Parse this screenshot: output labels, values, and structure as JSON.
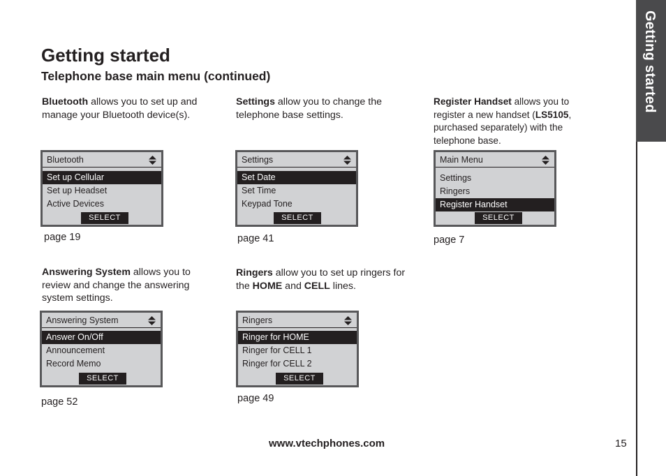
{
  "page": {
    "title": "Getting started",
    "section_title": "Telephone base main menu (continued)",
    "side_tab": "Getting started",
    "footer_url": "www.vtechphones.com",
    "page_number": "15"
  },
  "panels": [
    {
      "desc_bold": "Bluetooth",
      "desc_rest": " allows you to set up and manage your Bluetooth device(s).",
      "screen": {
        "header": "Bluetooth",
        "header_icon": "up-down-arrows-icon",
        "items": [
          "Set up Cellular",
          "Set up Headset",
          "Active Devices"
        ],
        "selected_index": 0,
        "softkey": "SELECT"
      },
      "page_ref": "page 19"
    },
    {
      "desc_bold": "Settings",
      "desc_rest": " allow you to change the telephone base settings.",
      "screen": {
        "header": "Settings",
        "header_icon": "up-down-arrows-icon",
        "items": [
          "Set Date",
          "Set Time",
          "Keypad Tone"
        ],
        "selected_index": 0,
        "softkey": "SELECT"
      },
      "page_ref": "page 41"
    },
    {
      "desc_bold": "Register Handset",
      "desc_part2": " allows you to register a new handset (",
      "desc_bold2": "LS5105",
      "desc_part3": ", purchased separately) with the telephone base.",
      "screen": {
        "header": "Main Menu",
        "header_icon": "up-down-arrows-icon",
        "items": [
          "Settings",
          "Ringers",
          "Register Handset"
        ],
        "selected_index": 2,
        "softkey": "SELECT"
      },
      "page_ref": "page 7"
    },
    {
      "desc_bold": "Answering System",
      "desc_rest": " allows you to review and change the answering system settings.",
      "screen": {
        "header": "Answering System",
        "header_icon": "up-down-arrows-icon",
        "items": [
          "Answer On/Off",
          "Announcement",
          "Record Memo"
        ],
        "selected_index": 0,
        "softkey": "SELECT"
      },
      "page_ref": "page 52"
    },
    {
      "desc_bold": "Ringers",
      "desc_part2": " allow you to set up ringers for the ",
      "desc_bold2": "HOME",
      "desc_part3": " and ",
      "desc_bold3": "CELL",
      "desc_part4": " lines.",
      "screen": {
        "header": "Ringers",
        "header_icon": "up-down-arrows-icon",
        "items": [
          "Ringer for HOME",
          "Ringer for CELL 1",
          "Ringer for CELL 2"
        ],
        "selected_index": 0,
        "softkey": "SELECT"
      },
      "page_ref": "page 49"
    }
  ]
}
